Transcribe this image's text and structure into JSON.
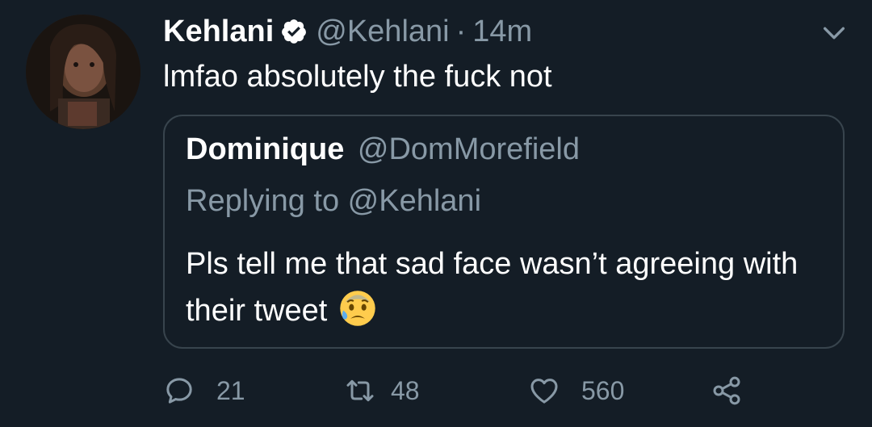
{
  "tweet": {
    "author_name": "Kehlani",
    "handle": "@Kehlani",
    "separator": "·",
    "time": "14m",
    "text": "lmfao absolutely the fuck not",
    "avatar_icon": "user-avatar"
  },
  "quoted_tweet": {
    "author_name": "Dominique",
    "handle": "@DomMorefield",
    "replying_to": "Replying to @Kehlani",
    "text": "Pls tell me that sad face wasn’t agreeing with their tweet",
    "emoji": "anxious-face-with-sweat"
  },
  "actions": {
    "reply_count": "21",
    "retweet_count": "48",
    "like_count": "560"
  },
  "colors": {
    "background": "#141d26",
    "secondary_text": "#8899a6",
    "border": "#38444d"
  }
}
